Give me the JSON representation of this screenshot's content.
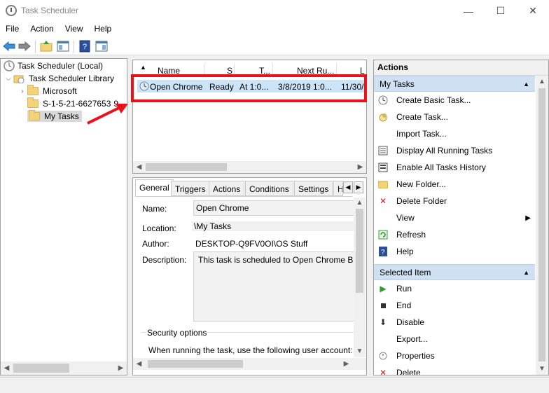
{
  "window": {
    "title": "Task Scheduler",
    "minimize": "—",
    "maximize": "☐",
    "close": "✕"
  },
  "menu": [
    "File",
    "Action",
    "View",
    "Help"
  ],
  "tree": {
    "root": "Task Scheduler (Local)",
    "library": "Task Scheduler Library",
    "items": [
      "Microsoft",
      "S-1-5-21-6627653",
      "My Tasks"
    ],
    "truncated_suffix": "9"
  },
  "tasklist": {
    "columns": [
      "Name",
      "S",
      "T...",
      "Next Ru...",
      "L"
    ],
    "row": {
      "name": "Open Chrome",
      "status": "Ready",
      "triggers": "At 1:0...",
      "next_run": "3/8/2019 1:0...",
      "last": "11/30/"
    }
  },
  "detail": {
    "tabs": [
      "General",
      "Triggers",
      "Actions",
      "Conditions",
      "Settings",
      "H"
    ],
    "name_label": "Name:",
    "name_value": "Open Chrome",
    "location_label": "Location:",
    "location_value": "\\My Tasks",
    "author_label": "Author:",
    "author_value": "DESKTOP-Q9FV0OI\\OS Stuff",
    "description_label": "Description:",
    "description_value": "This task is scheduled to Open Chrome Br",
    "security_label": "Security options",
    "security_text": "When running the task, use the following user account:"
  },
  "actions": {
    "title": "Actions",
    "section1": "My Tasks",
    "items1": [
      {
        "label": "Create Basic Task...",
        "icon": "wizard-icon"
      },
      {
        "label": "Create Task...",
        "icon": "task-icon"
      },
      {
        "label": "Import Task...",
        "icon": "blank-icon"
      },
      {
        "label": "Display All Running Tasks",
        "icon": "list-icon"
      },
      {
        "label": "Enable All Tasks History",
        "icon": "history-icon"
      },
      {
        "label": "New Folder...",
        "icon": "folder-icon"
      },
      {
        "label": "Delete Folder",
        "icon": "delete-icon"
      },
      {
        "label": "View",
        "icon": "blank-icon"
      },
      {
        "label": "Refresh",
        "icon": "refresh-icon"
      },
      {
        "label": "Help",
        "icon": "help-icon"
      }
    ],
    "section2": "Selected Item",
    "items2": [
      {
        "label": "Run",
        "icon": "run-icon"
      },
      {
        "label": "End",
        "icon": "stop-icon"
      },
      {
        "label": "Disable",
        "icon": "disable-icon"
      },
      {
        "label": "Export...",
        "icon": "blank-icon"
      },
      {
        "label": "Properties",
        "icon": "properties-icon"
      },
      {
        "label": "Delete",
        "icon": "delete-icon"
      }
    ]
  },
  "colors": {
    "annotation": "#e8141b",
    "header": "#cfe0f2"
  }
}
